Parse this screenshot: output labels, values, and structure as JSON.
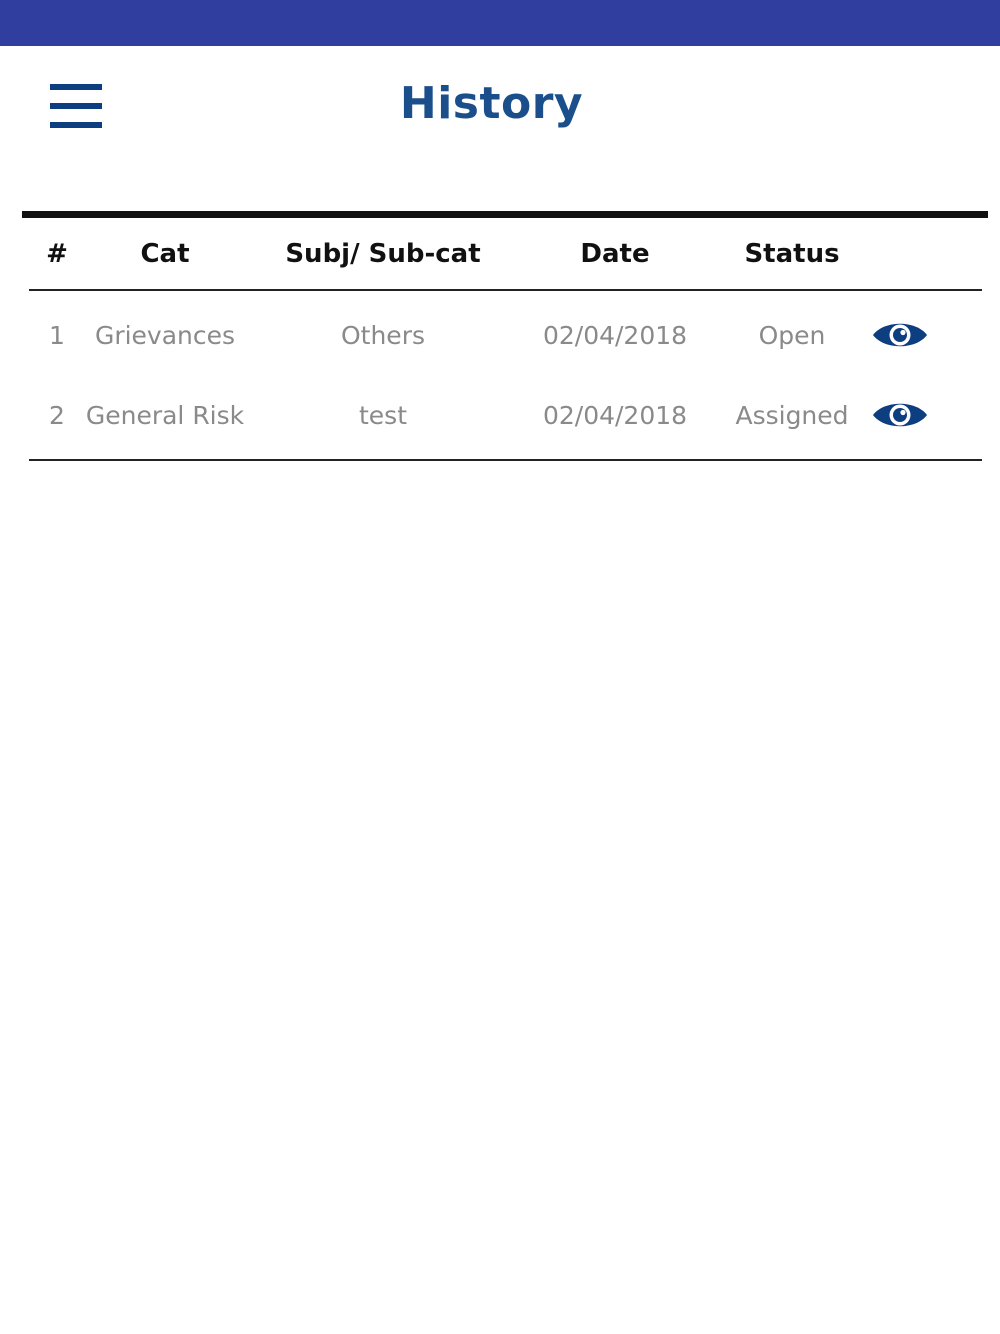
{
  "colors": {
    "status_bar": "#303f9f",
    "title": "#1a4f8b",
    "icon": "#0d3f80",
    "header_text": "#111111",
    "cell_text": "#8a8a8a"
  },
  "app_bar": {
    "menu_icon": "hamburger-menu-icon",
    "title": "History"
  },
  "table": {
    "headers": {
      "num": "#",
      "cat": "Cat",
      "sub": "Subj/ Sub-cat",
      "date": "Date",
      "status": "Status"
    },
    "rows": [
      {
        "num": "1",
        "cat": "Grievances",
        "sub": "Others",
        "date": "02/04/2018",
        "status": "Open",
        "action_icon": "eye-icon"
      },
      {
        "num": "2",
        "cat": "General Risk",
        "sub": "test",
        "date": "02/04/2018",
        "status": "Assigned",
        "action_icon": "eye-icon"
      }
    ]
  }
}
